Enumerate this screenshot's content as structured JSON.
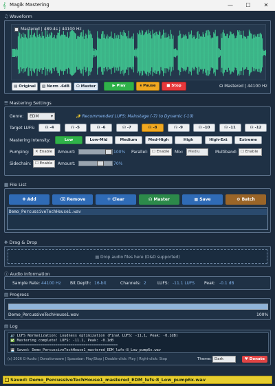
{
  "window": {
    "title": "Magik Mastering",
    "controls": [
      "—",
      "☐",
      "✕"
    ]
  },
  "waveform": {
    "header": "Waveform",
    "info": "Mastered  |  489.4s  |  44100 Hz",
    "views": [
      "Original",
      "Norm -6dB",
      "Master"
    ],
    "play": "▶ Play",
    "pause": "⏸ Pause",
    "stop": "■ Stop",
    "status": "Mastered  |  44100 Hz",
    "wave_color": "#3fc38f"
  },
  "mastering": {
    "header": "Mastering Settings",
    "genre_label": "Genre:",
    "genre_value": "EDM",
    "recommend": "✨ Recommended LUFS: Mainstage (-7) to Dynamic (-10)",
    "target_label": "Target LUFS:",
    "lufs": [
      "-4",
      "-5",
      "-6",
      "-7",
      "-8",
      "-9",
      "-10",
      "-11",
      "-12"
    ],
    "lufs_selected": "-8",
    "intensity_label": "Mastering Intensity:",
    "intensity": [
      "Low",
      "Low-Mid",
      "Medium",
      "Med-High",
      "High",
      "High-Ext",
      "Extreme"
    ],
    "intensity_selected": "Low",
    "pumping_label": "Pumping:",
    "enable": "Enable",
    "amount_label": "Amount:",
    "pumping_amount": "100%",
    "parallel_label": "Parallel:",
    "mix_label": "Mix:",
    "mix_value": "Mediu",
    "multiband_label": "Multiband:",
    "sidechain_label": "Sidechain:",
    "sidechain_amount": "70%"
  },
  "file_list": {
    "header": "File List",
    "buttons": {
      "add": "Add",
      "remove": "Remove",
      "clear": "Clear",
      "master": "Master",
      "save": "Save",
      "batch": "Batch"
    },
    "files": [
      "Demo_PercussiveTechHouse1.wav"
    ]
  },
  "drag_drop": {
    "header": "Drag & Drop",
    "hint": "Drop audio files here (D&D supported)"
  },
  "audio_info": {
    "header": "Audio Information",
    "sample_rate_label": "Sample Rate:",
    "sample_rate": "44100 Hz",
    "bit_depth_label": "Bit Depth:",
    "bit_depth": "16-bit",
    "channels_label": "Channels:",
    "channels": "2",
    "lufs_label": "LUFS:",
    "lufs": "-11.1 LUFS",
    "peak_label": "Peak:",
    "peak": "-0.1 dB"
  },
  "progress": {
    "header": "Progress",
    "file": "Demo_PercussiveTechHouse1.wav",
    "percent": "100%",
    "fraction": 1.0
  },
  "log": {
    "header": "Log",
    "lines": [
      "🔊 LUFS Normalization: Loudness optimization (Final LUFS: -11.1, Peak: -0.1dB)",
      "Mastering complete! LUFS: -11.1, Peak: -0.1dB",
      "==================================================",
      "Saved: Demo_PercussiveTechHouse1_mastered_EDM_lufs-8_Low_pump6x.wav"
    ]
  },
  "footer": {
    "copyright": "(c) 2026 G-Audio | Donationware | Spacebar: Play/Stop | Double-click: Play | Right-click: Stop",
    "theme_label": "Theme:",
    "theme_value": "Dark",
    "donate": "♥ Donate"
  },
  "status_bar": {
    "text": "Saved: Demo_PercussiveTechHouse1_mastered_EDM_lufs-8_Low_pump6x.wav"
  }
}
